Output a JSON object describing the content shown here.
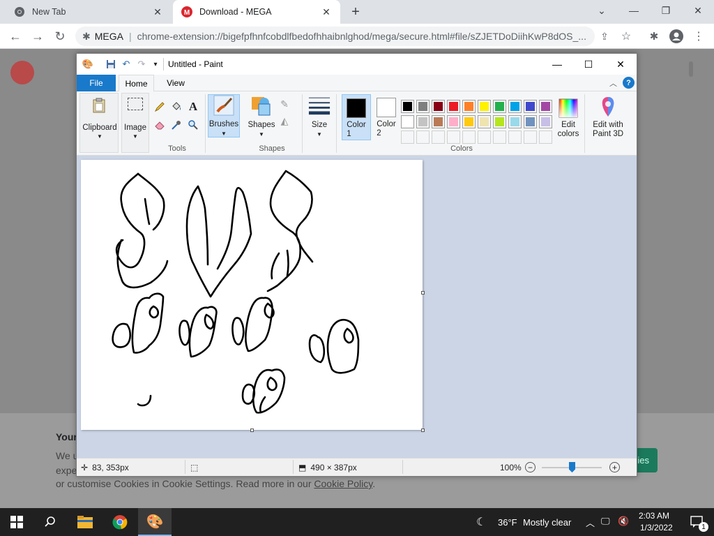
{
  "browser": {
    "tabs": [
      {
        "title": "New Tab",
        "active": false
      },
      {
        "title": "Download - MEGA",
        "active": true
      }
    ],
    "address": {
      "site_label": "MEGA",
      "url": "chrome-extension://bigefpfhnfcobdlfbedofhhaibnlghod/mega/secure.html#file/sZJETDoDiihKwP8dOS_..."
    }
  },
  "page": {
    "cookie": {
      "title": "Your",
      "line1": "We u",
      "line2": "expe",
      "line3_text": "or customise Cookies in Cookie Settings. Read more in our ",
      "line3_link": "Cookie Policy",
      "line3_end": ".",
      "accept_label": "ies"
    }
  },
  "paint": {
    "title": "Untitled - Paint",
    "ribbon_tabs": [
      "File",
      "Home",
      "View"
    ],
    "groups": {
      "clipboard": "Clipboard",
      "image": "Image",
      "tools": "Tools",
      "brushes": "Brushes",
      "shapes_btn": "Shapes",
      "shapes": "Shapes",
      "size": "Size",
      "color1": "Color\n1",
      "color2": "Color\n2",
      "colors": "Colors",
      "edit_colors": "Edit\ncolors",
      "edit_3d": "Edit with\nPaint 3D"
    },
    "palette_row1": [
      "#000000",
      "#7f7f7f",
      "#880015",
      "#ed1c24",
      "#ff7f27",
      "#fff200",
      "#22b14c",
      "#00a2e8",
      "#3f48cc",
      "#a349a4"
    ],
    "palette_row2": [
      "#ffffff",
      "#c3c3c3",
      "#b97a57",
      "#ffaec9",
      "#ffc90e",
      "#efe4b0",
      "#b5e61d",
      "#99d9ea",
      "#7092be",
      "#c8bfe7"
    ],
    "color1": "#000000",
    "color2": "#ffffff",
    "status": {
      "cursor_pos": "83, 353px",
      "canvas_size": "490 × 387px",
      "zoom": "100%"
    }
  },
  "taskbar": {
    "weather_temp": "36°F",
    "weather_desc": "Mostly clear",
    "time": "2:03 AM",
    "date": "1/3/2022",
    "notif_count": "1"
  }
}
